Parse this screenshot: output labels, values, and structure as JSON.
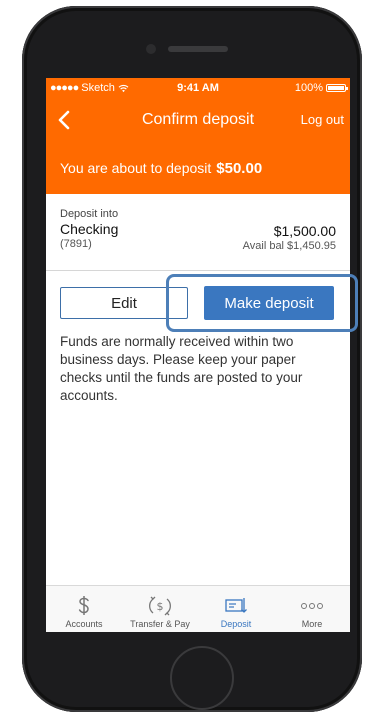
{
  "status_bar": {
    "carrier": "Sketch",
    "time": "9:41 AM",
    "battery": "100%"
  },
  "nav": {
    "title": "Confirm deposit",
    "logout": "Log out"
  },
  "banner": {
    "text": "You are about to deposit",
    "amount": "$50.00"
  },
  "account": {
    "label": "Deposit into",
    "name": "Checking",
    "number": "(7891)",
    "balance": "$1,500.00",
    "available": "Avail bal $1,450.95"
  },
  "actions": {
    "edit": "Edit",
    "make_deposit": "Make deposit"
  },
  "info": "Funds are normally received within two business days. Please keep your paper checks until the funds are posted to your accounts.",
  "tabs": [
    {
      "label": "Accounts",
      "icon": "dollar-icon"
    },
    {
      "label": "Transfer & Pay",
      "icon": "transfer-icon"
    },
    {
      "label": "Deposit",
      "icon": "deposit-check-icon",
      "active": true
    },
    {
      "label": "More",
      "icon": "more-dots-icon"
    }
  ],
  "colors": {
    "brand": "#ff6a00",
    "accent": "#3a77c0",
    "highlight": "#4d7fb8"
  }
}
